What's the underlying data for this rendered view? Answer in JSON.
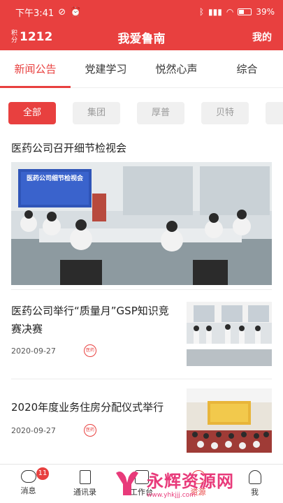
{
  "status_bar": {
    "time": "下午3:41",
    "battery": "39"
  },
  "app_bar": {
    "score_label": "积分",
    "score_value": "1212",
    "title": "我爱鲁南",
    "mine": "我的"
  },
  "tabs": [
    {
      "label": "新闻公告",
      "active": true
    },
    {
      "label": "党建学习",
      "active": false
    },
    {
      "label": "悦然心声",
      "active": false
    },
    {
      "label": "综合",
      "active": false
    }
  ],
  "chips": [
    {
      "label": "全部",
      "active": true
    },
    {
      "label": "集团",
      "active": false
    },
    {
      "label": "厚普",
      "active": false
    },
    {
      "label": "贝特",
      "active": false
    }
  ],
  "featured": {
    "title": "医药公司召开细节检视会",
    "banner": "医药公司细节检视会"
  },
  "news": [
    {
      "title": "医药公司举行“质量月”GSP知识竞赛决赛",
      "date": "2020-09-27",
      "stamp": "医药"
    },
    {
      "title": "2020年度业务住房分配仪式举行",
      "date": "2020-09-27",
      "stamp": "医药"
    }
  ],
  "bottom_nav": [
    {
      "label": "消息",
      "icon": "chat-icon",
      "badge": "11"
    },
    {
      "label": "通讯录",
      "icon": "contacts-icon"
    },
    {
      "label": "工作台",
      "icon": "workbench-icon"
    },
    {
      "label": "资源",
      "icon": "resource-icon",
      "active": true
    },
    {
      "label": "我",
      "icon": "me-icon"
    }
  ],
  "watermark": {
    "main": "永辉资源网",
    "sub": "www.yhkjjj.com"
  },
  "colors": {
    "accent": "#e8403f"
  }
}
